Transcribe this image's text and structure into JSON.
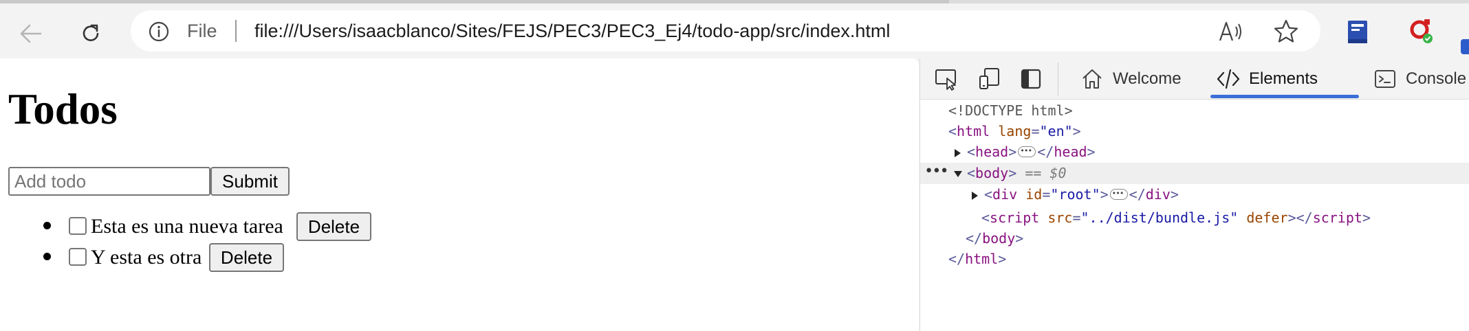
{
  "browser": {
    "address_prefix": "File",
    "url": "file:///Users/isaacblanco/Sites/FEJS/PEC3/PEC3_Ej4/todo-app/src/index.html"
  },
  "page": {
    "title": "Todos",
    "input_placeholder": "Add todo",
    "input_value": "",
    "submit_label": "Submit",
    "todos": [
      {
        "text": "Esta es una nueva tarea",
        "checked": false,
        "delete_label": "Delete"
      },
      {
        "text": "Y esta es otra",
        "checked": false,
        "delete_label": "Delete"
      }
    ]
  },
  "devtools": {
    "tabs": [
      {
        "label": "Welcome",
        "icon": "home-icon",
        "active": false
      },
      {
        "label": "Elements",
        "icon": "code-icon",
        "active": true
      },
      {
        "label": "Console",
        "icon": "console-icon",
        "active": false
      }
    ],
    "dom": {
      "doctype": "<!DOCTYPE html>",
      "html_open_tag": "html",
      "html_lang_attr": "lang",
      "html_lang_value": "\"en\"",
      "head_tag": "head",
      "body_tag": "body",
      "body_marker": "== $0",
      "div_tag": "div",
      "div_attr": "id",
      "div_value": "\"root\"",
      "script_tag": "script",
      "script_attr": "src",
      "script_value": "\"../dist/bundle.js\"",
      "script_defer": "defer"
    }
  },
  "colors": {
    "accent": "#3a6fd8",
    "tag": "#881280",
    "attr_name": "#994500",
    "attr_value": "#1a1aa6"
  }
}
